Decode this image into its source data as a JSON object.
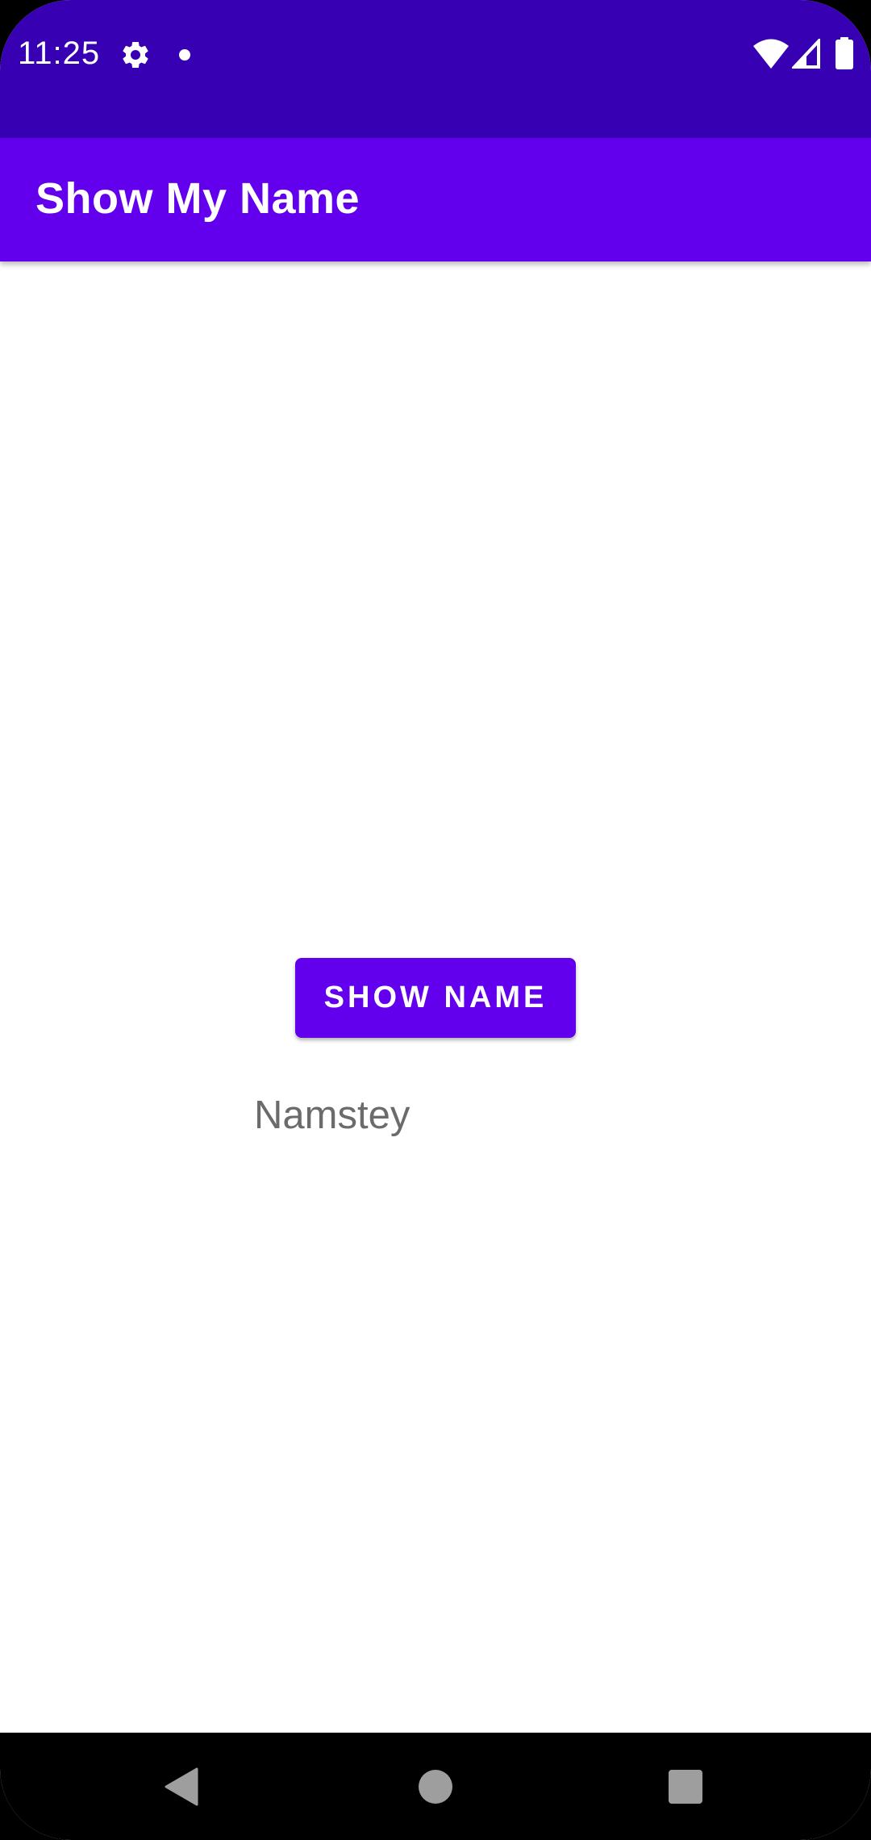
{
  "status_bar": {
    "time": "11:25",
    "icons": [
      "gear-icon",
      "notification-dot-icon",
      "wifi-icon",
      "cell-signal-icon",
      "battery-icon"
    ],
    "background_color": "#3700b3"
  },
  "app_bar": {
    "title": "Show My Name",
    "background_color": "#6200ee"
  },
  "main": {
    "show_name_button_label": "SHOW NAME",
    "button_color": "#6200ee",
    "name_text": "Namstey"
  },
  "nav_bar": {
    "icons": [
      "back-icon",
      "home-icon",
      "recents-icon"
    ]
  }
}
